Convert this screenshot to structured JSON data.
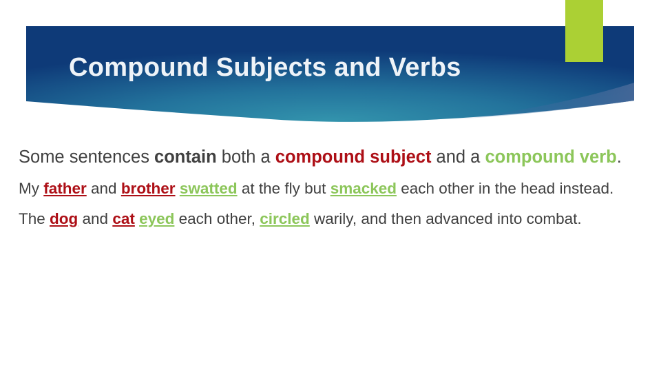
{
  "slide": {
    "title": "Compound Subjects and Verbs",
    "colors": {
      "banner_dark": "#0e3a78",
      "banner_light": "#2f8aa8",
      "accent_green_bar": "#abd034",
      "text_gray": "#404040",
      "subject_red": "#ad0f16",
      "verb_green": "#8cc65a"
    }
  },
  "content": {
    "lead": {
      "t1": "Some sentences ",
      "t2": "contain",
      "t3": " both a ",
      "t4": "compound subject",
      "t5": " and a ",
      "t6": "compound verb",
      "t7": "."
    },
    "example1": {
      "t1": "My ",
      "subject1": "father",
      "t2": " and ",
      "subject2": "brother",
      "t3": " ",
      "verb1": "swatted",
      "t4": " at the fly but ",
      "verb2": "smacked",
      "t5": " each other in the head instead."
    },
    "example2": {
      "t1": "The ",
      "subject1": "dog",
      "t2": " and ",
      "subject2": "cat",
      "t3": " ",
      "verb1": "eyed",
      "t4": " each other, ",
      "verb2": "circled",
      "t5": " warily, and then advanced into combat."
    }
  }
}
